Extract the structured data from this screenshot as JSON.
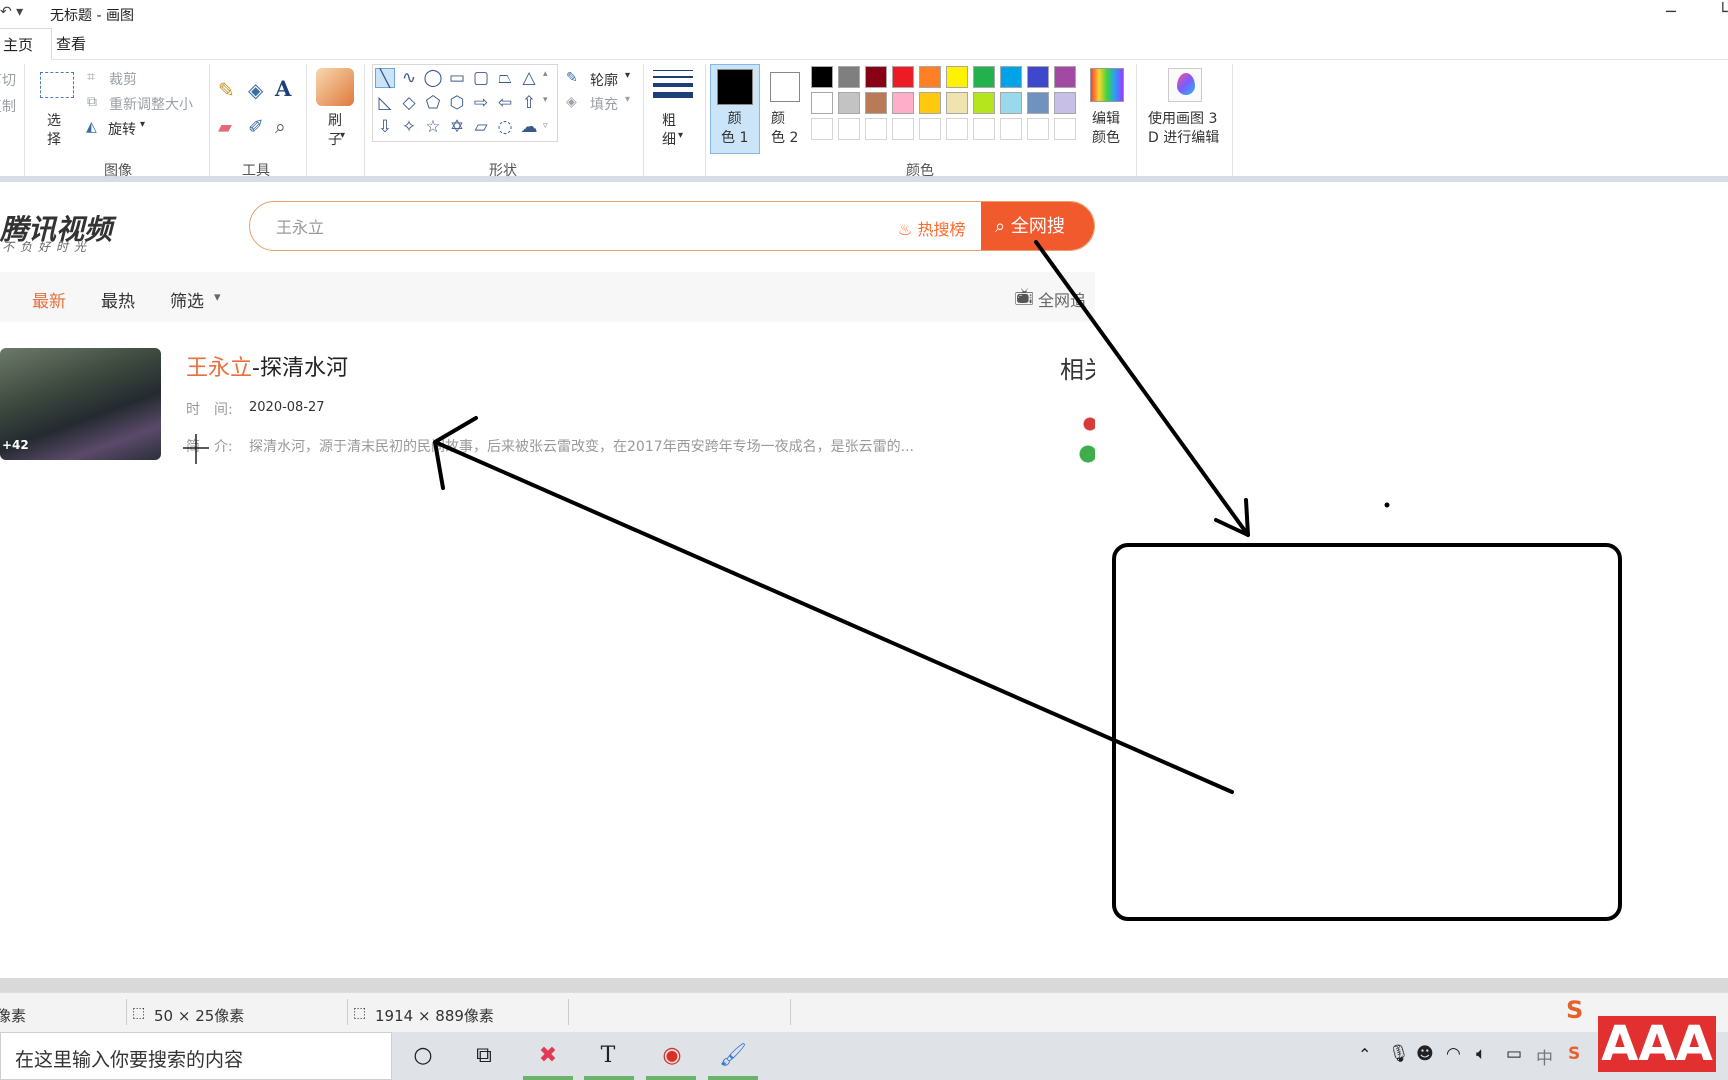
{
  "titlebar": {
    "quick_access": "↶ ▾",
    "title": "无标题 - 画图",
    "minimize": "─",
    "restore": "└"
  },
  "tabs": [
    {
      "label": "主页"
    },
    {
      "label": "查看"
    }
  ],
  "ribbon": {
    "clipboard": {
      "cut": "剪切",
      "copy": "复制"
    },
    "image": {
      "select": "选\n择",
      "crop": "裁剪",
      "resize": "重新调整大小",
      "rotate": "旋转",
      "group_label": "图像"
    },
    "tools": {
      "group_label": "工具"
    },
    "brush": {
      "label": "刷\n子"
    },
    "shapes": {
      "outline": "轮廓",
      "fill": "填充",
      "group_label": "形状"
    },
    "size": {
      "label": "粗\n细"
    },
    "color1": {
      "label": "颜\n色 1"
    },
    "color2": {
      "label": "颜\n色 2"
    },
    "edit_colors": {
      "label": "编辑\n颜色"
    },
    "paint3d": {
      "label": "使用画图 3\nD 进行编辑"
    },
    "colors_group_label": "颜色",
    "palette_row1": [
      "#000000",
      "#7f7f7f",
      "#880015",
      "#ed1c24",
      "#ff7f27",
      "#fff200",
      "#22b14c",
      "#00a2e8",
      "#3f48cc",
      "#a349a4"
    ],
    "palette_row2": [
      "#ffffff",
      "#c3c3c3",
      "#b97a57",
      "#ffaec9",
      "#ffc90e",
      "#efe4b0",
      "#b5e61d",
      "#99d9ea",
      "#7092be",
      "#c8bfe7"
    ]
  },
  "web": {
    "logo": "腾讯视频",
    "slogan": "不负好时光",
    "search_value": "王永立",
    "hot_rank": "热搜榜",
    "search_button": "全网搜",
    "filters": [
      "最新",
      "最热",
      "筛选"
    ],
    "follow": "全网追",
    "video": {
      "title_highlight": "王永立",
      "title_rest": "-探清水河",
      "thumb_badge": "+42",
      "time_label": "时　间:",
      "time_value": "2020-08-27",
      "intro_label": "简　介:",
      "intro_value": "探清水河，源于清末民初的民间故事，后来被张云雷改变，在2017年西安跨年专场一夜成名，是张云雷的...",
      "related": "相关"
    }
  },
  "statusbar": {
    "pos": "像素",
    "selection": "50 × 25像素",
    "canvas_size": "1914 × 889像素"
  },
  "taskbar": {
    "search_placeholder": "在这里输入你要搜索的内容",
    "ime": "中",
    "aaa": "AAA"
  }
}
